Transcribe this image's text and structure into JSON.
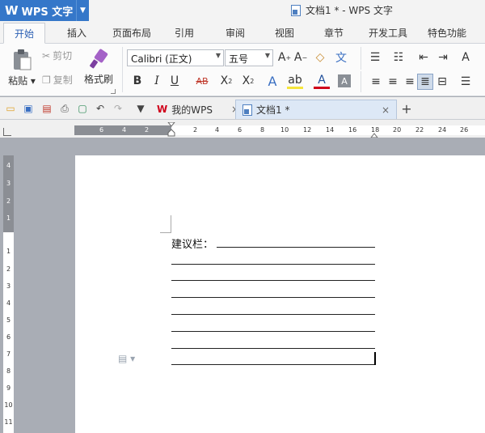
{
  "titlebar": {
    "app_name": "WPS 文字",
    "document_title": "文档1 * - WPS 文字"
  },
  "ribbon_tabs": [
    "开始",
    "插入",
    "页面布局",
    "引用",
    "审阅",
    "视图",
    "章节",
    "开发工具",
    "特色功能"
  ],
  "active_tab": "开始",
  "clipboard": {
    "paste": "粘贴",
    "cut": "剪切",
    "copy": "复制",
    "format_painter": "格式刷"
  },
  "font": {
    "family": "Calibri (正文)",
    "size": "五号"
  },
  "quick_access": {
    "doc_tabs": [
      {
        "label": "我的WPS",
        "active": false
      },
      {
        "label": "文档1 *",
        "active": true
      }
    ]
  },
  "ruler": {
    "horizontal_numbers": [
      "6",
      "4",
      "2",
      "2",
      "4",
      "6",
      "8",
      "10",
      "12",
      "14",
      "16",
      "18",
      "20",
      "22",
      "24",
      "26"
    ],
    "vertical_numbers": [
      "4",
      "3",
      "2",
      "1",
      "1",
      "2",
      "3",
      "4",
      "5",
      "6",
      "7",
      "8",
      "9",
      "10",
      "11"
    ]
  },
  "document": {
    "suggestion_label": "建议栏："
  },
  "colors": {
    "app_blue": "#3577c9",
    "active_tab_text": "#2b5fb3",
    "ruler_dark": "#8b8e94",
    "canvas": "#a9adb5"
  }
}
